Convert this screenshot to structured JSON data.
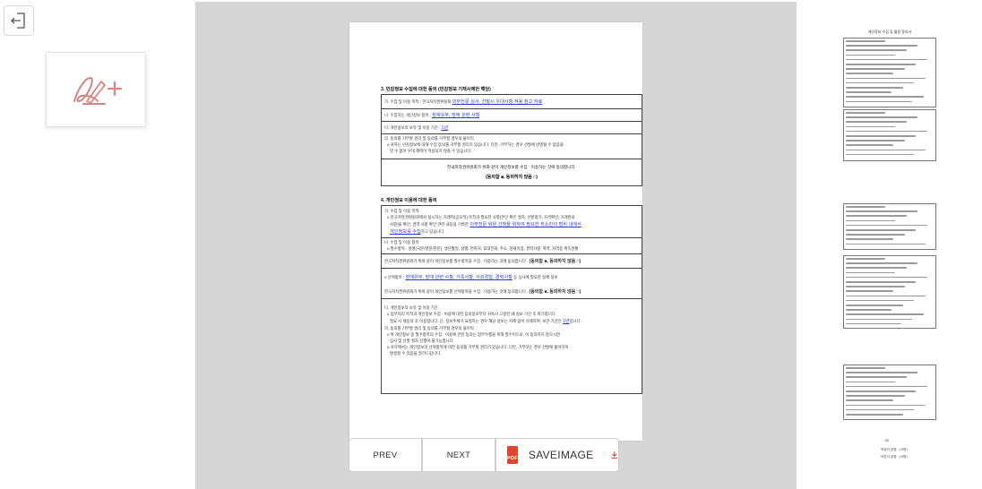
{
  "toolbar": {
    "exit_icon": "exit-icon",
    "sign_icon": "signature-add-icon",
    "prev_label": "PREV",
    "next_label": "NEXT",
    "save_label": "SAVEIMAGE",
    "pdf_icon_text": "PDF",
    "download_icon": "download-icon",
    "accent": "#e0452b"
  },
  "document": {
    "section3": {
      "title": "3. 민감정보 수집에 대한 동의 (민감정보 기재시에만 해당)",
      "line1_prefix": "가. 수집 및 이용 목적 : 한국저작권위원회 ",
      "line1_link": "외부전문 심사, 선발시 우대사항 적용 참고 자료",
      "line2_prefix": "나. 수집하는 개인정보 항목 : ",
      "line2_link": "장애유무, 장애 관련 사항",
      "line3_prefix": "다. 개인정보의 보유 및 이용 기간 : ",
      "line3_link": "1년",
      "line4": "라. 동의를 거부할 권리 및 동의를 거부할 경우의 불이익",
      "line5": "o 귀하는 민감정보에 대해 수집 동의를 거부할 권리가 있습니다. 다만, 거부하는 경우 선발에 반영될 수 없음을",
      "line6": "알 수 없어 우대 혜택이 적용되지 않을 수 있습니다.",
      "consent_text": "한국저작권위원회가 위와 같이 개인정보를 수집 · 이용하는 것에 동의합니다.",
      "consent_choice": "(동의함 ■, 동의하지 않음 □)"
    },
    "section4": {
      "title": "4. 개인정보 이용에 대한 동의",
      "line1": "가. 수집 및 이용 목적",
      "line2": "o 한국저작권위원회에서 실시하는 거래적(공모적) 목적과 필요한 사항(본인 확인 절차, 선발평가, 자격확인, 거래완료",
      "line3_prefix": "사항)을 확인, 경력 사항 확인 관련 내용을 기록한 ",
      "line3_link": "외부전문 위원 선정을 위하여 필요한 최소한의 범위 내에서",
      "line4_link": "개인정보를 수집",
      "line4_suffix": "하고 있습니다.",
      "line5": "나. 수집 및 이용 항목",
      "line6": "o 필수항목 : 성명(국문/영문/한문), 생년월일, 성별, 연락처, 휴대전화, 주소, 현재직업, 경력사항, 학력, 자격증 취득현황",
      "consent1": "한국저작권위원회가 위와 같이 개인정보를 필수항목을 수집 · 이용하는 것에 동의합니다.",
      "choice1": "(동의함 ■, 동의하지 않음 □)",
      "line7_prefix": "o 선택항목 : ",
      "line7_link": "장애유무, 장애 관련 사항, 가족사항, 사회경험, 경력사항",
      "line7_suffix": " 등 심사에 필요한 일체 정보",
      "consent2": "한국저작권위원회가 위와 같이 개인정보를 선택항목을 수집 · 이용하는 것에 동의합니다.",
      "choice2": "(동의함 ■, 동의하지 않음 □)",
      "line8": "다. 개인정보의 보유 및 이용 기간",
      "line9": "o 업무처리 목적과 개인정보 수집 · 이용에 대한 동의일로부터 귀속시 고정한 때 정보 기간 후 파기합니다.",
      "line10_prefix": "필요 시 재동의 후 이용합니다. 단, 정보주체가 요청하는 경우 해당 정보는 지체 없이 삭제하며, 보관 기간은 ",
      "line10_link": "1년",
      "line10_suffix": "입니다.",
      "line11": "라. 동의를 거부할 권리 및 동의를 거부할 경우의 불이익",
      "line12": "o 위 개인정보 중 필수항목의 수집 · 이용에 관한 동의는 업무수행을 위해 필수이므로, 이 동의하지 않으시면",
      "line13": "심사 및 선발 절차 진행이 불가능합니다.",
      "line14": "o 귀하께서는 개인정보의 선택항목에 대한 동의를 거부할 권리가 있습니다. 다만, 거부하는 경우 선발에 불이익이",
      "line15": "발생할 수 있음을 알려드립니다."
    }
  },
  "thumbnails": {
    "page1_title": "개인정보 수집 및 활용 동의서",
    "page3_date": "20 . . .",
    "page3_sign1": "작성자 성명 :           (서명)",
    "page3_sign2": "보호자 성명 :           (서명)"
  }
}
